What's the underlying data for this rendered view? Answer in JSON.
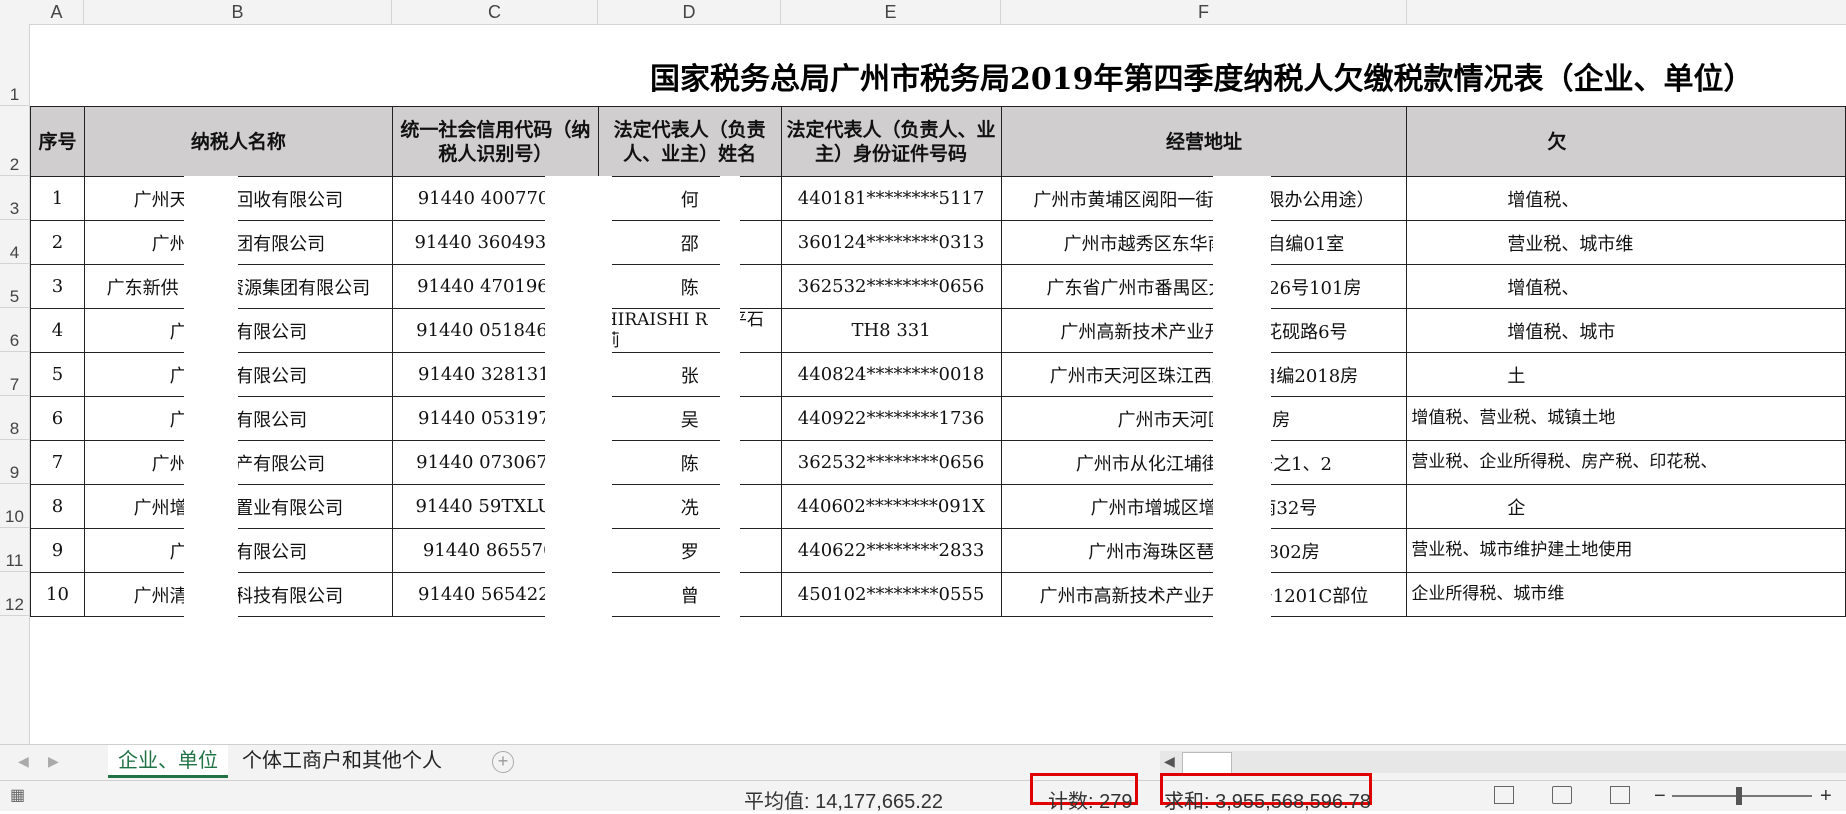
{
  "columns": [
    "A",
    "B",
    "C",
    "D",
    "E",
    "F"
  ],
  "rows": [
    "1",
    "2",
    "3",
    "4",
    "5",
    "6",
    "7",
    "8",
    "9",
    "10",
    "11",
    "12"
  ],
  "title": "国家税务总局广州市税务局2019年第四季度纳税人欠缴税款情况表（企业、单位）",
  "headers": {
    "seq": "序号",
    "name": "纳税人名称",
    "code": "统一社会信用代码（纳税人识别号）",
    "rep": "法定代表人（负责人、业主）姓名",
    "id": "法定代表人（负责人、业主）身份证件号码",
    "addr": "经营地址",
    "tax": "欠"
  },
  "records": [
    {
      "seq": "1",
      "name": "广州天    再     源回收有限公司",
      "code": "91440      4007704P",
      "rep": "何",
      "id": "440181********5117",
      "addr": "广州市黄埔区阅阳一街4号          仅限办公用途）",
      "tax": "增值税、"
    },
    {
      "seq": "2",
      "name": "广州     印     集团有限公司",
      "code": "91440      3604930W",
      "rep": "邵",
      "id": "360124********0313",
      "addr": "广州市越秀区东华南路         房自编01室",
      "tax": "营业税、城市维"
    },
    {
      "seq": "3",
      "name": "广东新供     天供      资源集团有限公司",
      "code": "91440      470196XT",
      "rep": "陈",
      "id": "362532********0656",
      "addr": "广东省广州市番禺区大石        路26号101房",
      "tax": "增值税、"
    },
    {
      "seq": "4",
      "name": "广     盛     子有限公司",
      "code": "91440      0518466U",
      "rep": "HIRAISHI R      （平石莉",
      "id": "TH8     331",
      "addr": "广州高新技术产业开发        茶花砚路6号",
      "tax": "增值税、城市"
    },
    {
      "seq": "5",
      "name": "广     市     业有限公司",
      "code": "91440      32813113",
      "rep": "张",
      "id": "440824********0018",
      "addr": "广州市天河区珠江西路8        2自编2018房",
      "tax": "土"
    },
    {
      "seq": "6",
      "name": "广     华     业有限公司",
      "code": "91440      05319792",
      "rep": "吴",
      "id": "440922********1736",
      "addr": "广州市天河区马         01房",
      "tax": "增值税、营业税、城镇土地"
    },
    {
      "seq": "7",
      "name": "广州     宏     地产有限公司",
      "code": "91440      0730674U",
      "rep": "陈",
      "id": "362532********0656",
      "addr": "广州市从化江埔街从         1号之1、2",
      "tax": "营业税、企业所得税、房产税、印花税、"
    },
    {
      "seq": "8",
      "name": "广州增     区     昇置业有限公司",
      "code": "91440      59TXLU17",
      "rep": "冼",
      "id": "440602********091X",
      "addr": "广州市增城区增江        江南32号",
      "tax": "企"
    },
    {
      "seq": "9",
      "name": "广     市     览有限公司",
      "code": "91440      865570B",
      "rep": "罗",
      "id": "440622********2833",
      "addr": "广州市海珠区琶洲        号1802房",
      "tax": "营业税、城市维护建土地使用"
    },
    {
      "seq": "10",
      "name": "广州清     瑞     息科技有限公司",
      "code": "91440      56542284",
      "rep": "曾",
      "id": "450102********0555",
      "addr": "广州市高新技术产业开发        9号1201C部位",
      "tax": "企业所得税、城市维"
    }
  ],
  "tabs": [
    {
      "label": "企业、单位",
      "active": true
    },
    {
      "label": "个体工商户和其他个人",
      "active": false
    }
  ],
  "addsheet_symbol": "+",
  "status": {
    "average": "平均值: 14,177,665.22",
    "count": "计数: 279",
    "sum": "求和: 3,955,568,596.78",
    "zoom_minus": "−",
    "zoom_plus": "+"
  },
  "colors": {
    "highlight": "#e00000",
    "active_tab": "#217346",
    "header_fill": "#d0cece"
  }
}
